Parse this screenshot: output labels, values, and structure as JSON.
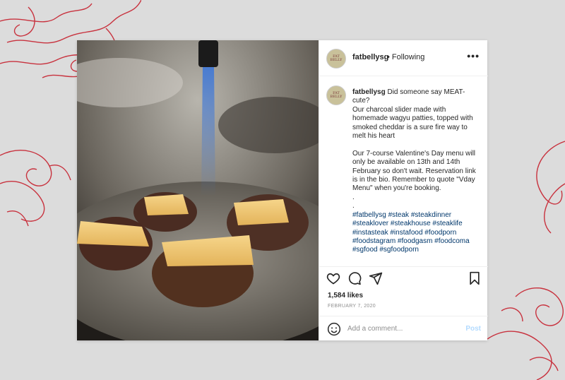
{
  "post": {
    "username": "fatbellysg",
    "follow_status": "• Following",
    "more_label": "•••",
    "avatar_text": "FAT BELLY",
    "caption_intro": " Did someone say MEAT-cute?\nOur charcoal slider made with homemade wagyu patties, topped with smoked cheddar is a sure fire way to melt his heart\n\nOur 7-course Valentine's Day menu will only be available on 13th and 14th February so don't wait. Reservation link is in the bio. Remember to quote \"Vday Menu\" when you're booking.\n.\n.\n",
    "hashtags": "#fatbellysg #steak #steakdinner #steaklover #steakhouse #steaklife #instasteak #instafood #foodporn #foodstagram #foodgasm #foodcoma #sgfood #sgfoodporn",
    "likes": "1,584 likes",
    "date": "FEBRUARY 7, 2020",
    "comment_placeholder": "Add a comment...",
    "post_label": "Post"
  },
  "icons": {
    "like": "heart-icon",
    "comment": "comment-icon",
    "share": "share-icon",
    "save": "bookmark-icon",
    "emoji": "emoji-icon",
    "more": "more-icon"
  },
  "colors": {
    "background": "#dcdcdc",
    "ornament": "#c8323e",
    "link": "#00376b",
    "post_button": "#b3dbff"
  }
}
